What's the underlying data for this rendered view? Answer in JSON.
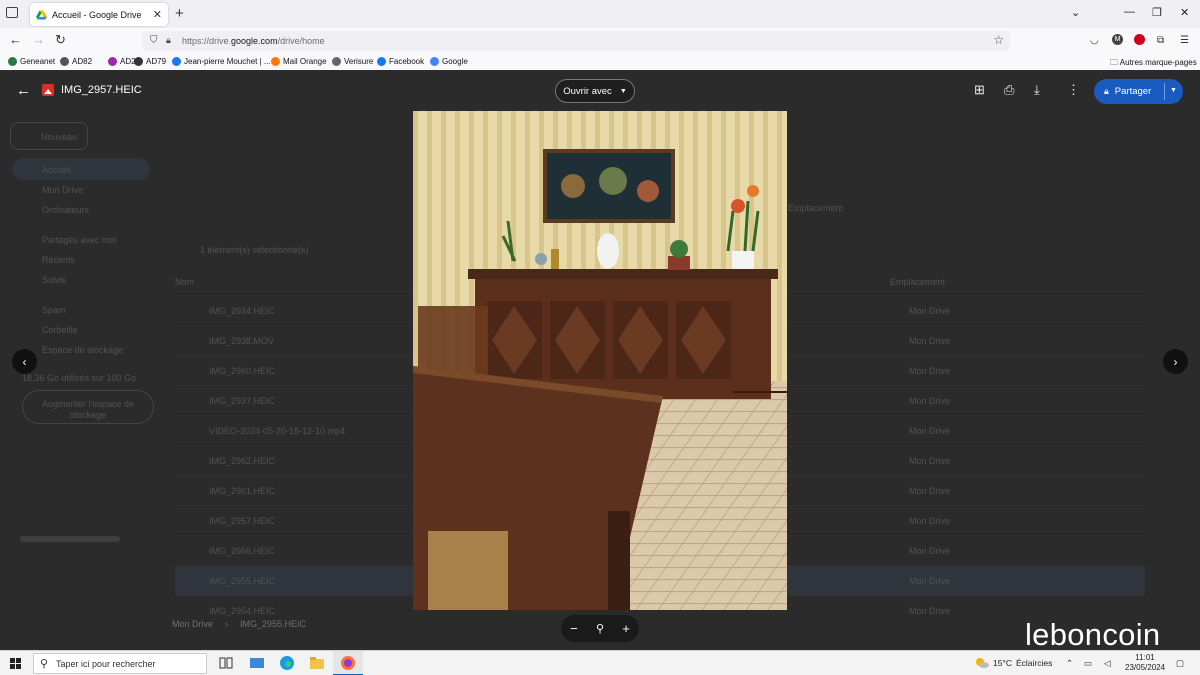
{
  "browser": {
    "tab_title": "Accueil - Google Drive",
    "url_prefix": "https://drive.",
    "url_domain": "google.com",
    "url_suffix": "/drive/home",
    "profile_initial": "M"
  },
  "bookmarks": [
    {
      "label": "Geneanet",
      "color": "#2a7a3d"
    },
    {
      "label": "AD82",
      "color": "#555555"
    },
    {
      "label": "AD24",
      "color": "#9c27b0"
    },
    {
      "label": "AD79",
      "color": "#333333"
    },
    {
      "label": "Jean-pierre Mouchet | ...",
      "color": "#1877f2"
    },
    {
      "label": "Mail Orange",
      "color": "#ff7900"
    },
    {
      "label": "Verisure",
      "color": "#666666"
    },
    {
      "label": "Facebook",
      "color": "#1877f2"
    },
    {
      "label": "Google",
      "color": "#4285f4"
    }
  ],
  "other_bookmarks": "Autres marque-pages",
  "viewer": {
    "file_name": "IMG_2957.HEIC",
    "open_with": "Ouvrir avec",
    "share_label": "Partager",
    "breadcrumb_root": "Mon Drive",
    "breadcrumb_file": "IMG_2955.HEIC"
  },
  "background_drive": {
    "new_button": "Nouveau",
    "nav": [
      "Accueil",
      "Mon Drive",
      "Ordinateurs",
      "Partagés avec moi",
      "Récents",
      "Suivis",
      "Spam",
      "Corbeille",
      "Espace de stockage"
    ],
    "storage_text": "18,36 Go utilisés sur 100 Go",
    "upgrade_button": "Augmenter l'espace de stockage",
    "selection_text": "1 élément(s) sélectionné(s)",
    "col_name": "Nom",
    "col_location": "Emplacement",
    "location_filter": "Emplacement",
    "files": [
      "IMG_2934.HEIC",
      "IMG_2938.MOV",
      "IMG_2960.HEIC",
      "IMG_2937.HEIC",
      "VIDEO-2024-05-20-18-12-10.mp4",
      "IMG_2962.HEIC",
      "IMG_2961.HEIC",
      "IMG_2957.HEIC",
      "IMG_2956.HEIC",
      "IMG_2955.HEIC",
      "IMG_2954.HEIC"
    ],
    "file_location": "Mon Drive"
  },
  "watermark": "leboncoin",
  "taskbar": {
    "search_placeholder": "Taper ici pour rechercher",
    "weather_temp": "15°C",
    "weather_text": "Éclaircies",
    "time": "11:01",
    "date": "23/05/2024"
  }
}
